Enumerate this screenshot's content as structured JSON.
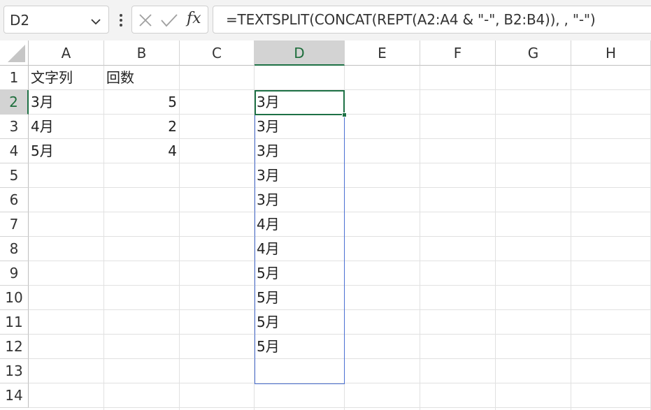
{
  "name_box": {
    "value": "D2"
  },
  "formula_bar": {
    "formula": "=TEXTSPLIT(CONCAT(REPT(A2:A4 & \"-\", B2:B4)), , \"-\")",
    "fx_label": "fx"
  },
  "columns": [
    "A",
    "B",
    "C",
    "D",
    "E",
    "F",
    "G",
    "H"
  ],
  "rows": [
    "1",
    "2",
    "3",
    "4",
    "5",
    "6",
    "7",
    "8",
    "9",
    "10",
    "11",
    "12",
    "13",
    "14"
  ],
  "active": {
    "column": "D",
    "row": "2"
  },
  "cells": {
    "A1": "文字列",
    "B1": "回数",
    "A2": "3月",
    "B2": "5",
    "A3": "4月",
    "B3": "2",
    "A4": "5月",
    "B4": "4"
  },
  "spill_values": [
    "3月",
    "3月",
    "3月",
    "3月",
    "3月",
    "4月",
    "4月",
    "5月",
    "5月",
    "5月",
    "5月"
  ],
  "colors": {
    "accent_green": "#1e7145",
    "spill_border": "#4a6fd3"
  }
}
